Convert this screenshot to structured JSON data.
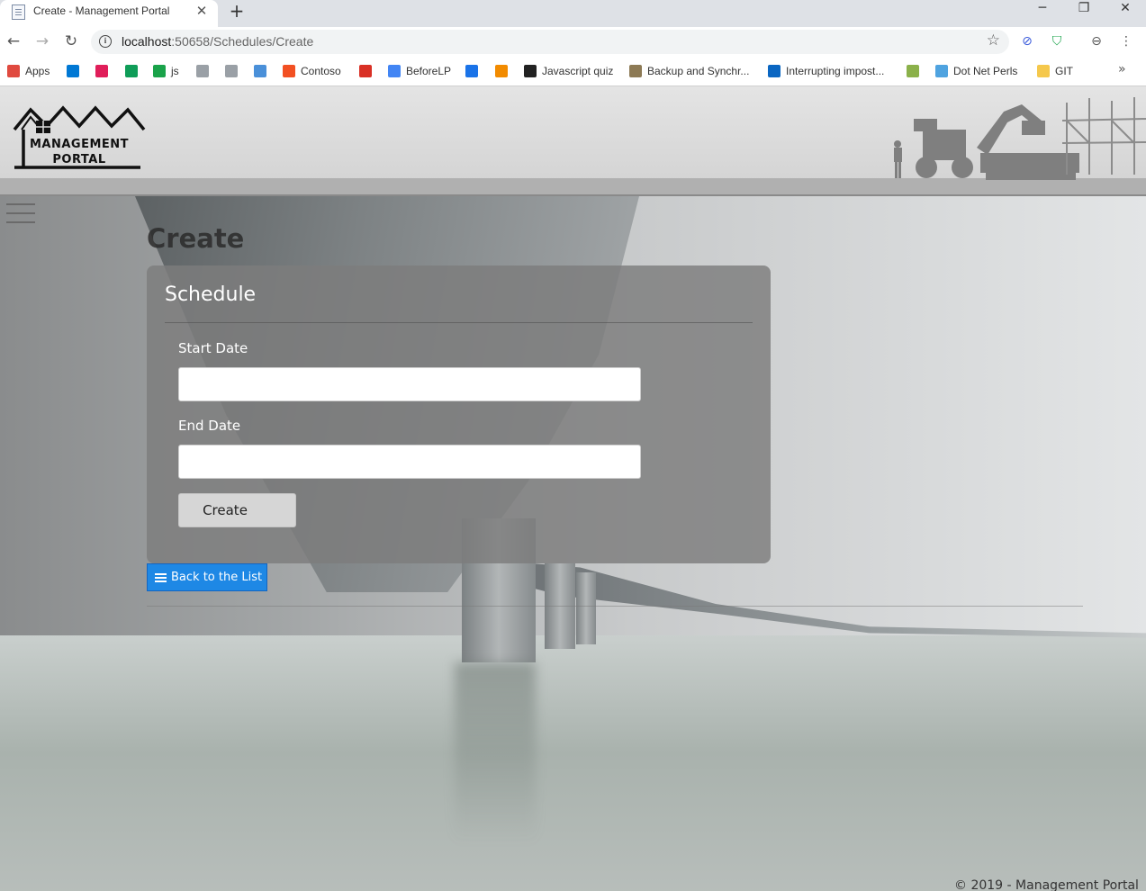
{
  "browser": {
    "tab_title": "Create - Management Portal",
    "tab_close": "✕",
    "new_tab": "+",
    "window_controls": {
      "minimize": "─",
      "restore": "❐",
      "close": "✕"
    },
    "url_host": "localhost",
    "url_path": ":50658/Schedules/Create",
    "bookmarks": [
      {
        "label": "Apps",
        "icon": "apps-grid-icon",
        "color": "#e04a3f"
      },
      {
        "label": "",
        "icon": "azure-devops-icon",
        "color": "#0078d4"
      },
      {
        "label": "",
        "icon": "slack-icon",
        "color": "#e01e5a"
      },
      {
        "label": "",
        "icon": "hangouts-icon",
        "color": "#0f9d58"
      },
      {
        "label": "js",
        "icon": "s-logo-icon",
        "color": "#1aa34a"
      },
      {
        "label": "",
        "icon": "edge-icon",
        "color": "#9aa0a6"
      },
      {
        "label": "",
        "icon": "edge-icon",
        "color": "#9aa0a6"
      },
      {
        "label": "",
        "icon": "cloud-icon",
        "color": "#4a90d9"
      },
      {
        "label": "Contoso",
        "icon": "microsoft-icon",
        "color": "#f25022"
      },
      {
        "label": "",
        "icon": "gmail-icon",
        "color": "#d93025"
      },
      {
        "label": "BeforeLP",
        "icon": "docs-icon",
        "color": "#4285f4"
      },
      {
        "label": "",
        "icon": "calendar-icon",
        "color": "#1a73e8"
      },
      {
        "label": "",
        "icon": "orange-p-icon",
        "color": "#f28b00"
      },
      {
        "label": "Javascript quiz",
        "icon": "github-icon",
        "color": "#222222"
      },
      {
        "label": "Backup and Synchr...",
        "icon": "photo-icon",
        "color": "#8d7a55"
      },
      {
        "label": "Interrupting impost...",
        "icon": "linkedin-icon",
        "color": "#0a66c2"
      },
      {
        "label": "",
        "icon": "dh-icon",
        "color": "#8bb14a"
      },
      {
        "label": "Dot Net Perls",
        "icon": "tiles-icon",
        "color": "#4fa3e0"
      },
      {
        "label": "GIT",
        "icon": "folder-icon",
        "color": "#f5c84c"
      }
    ],
    "more_bookmarks": "»"
  },
  "header": {
    "logo_line1": "MANAGEMENT",
    "logo_line2": "PORTAL"
  },
  "main": {
    "page_title": "Create",
    "card_title": "Schedule",
    "start_date_label": "Start Date",
    "start_date_value": "",
    "end_date_label": "End Date",
    "end_date_value": "",
    "create_button": "Create",
    "back_button": "Back to the List"
  },
  "footer": {
    "text": "© 2019 - Management Portal"
  },
  "colors": {
    "accent_blue": "#1e88e5",
    "card_bg": "#7d7d7d"
  }
}
